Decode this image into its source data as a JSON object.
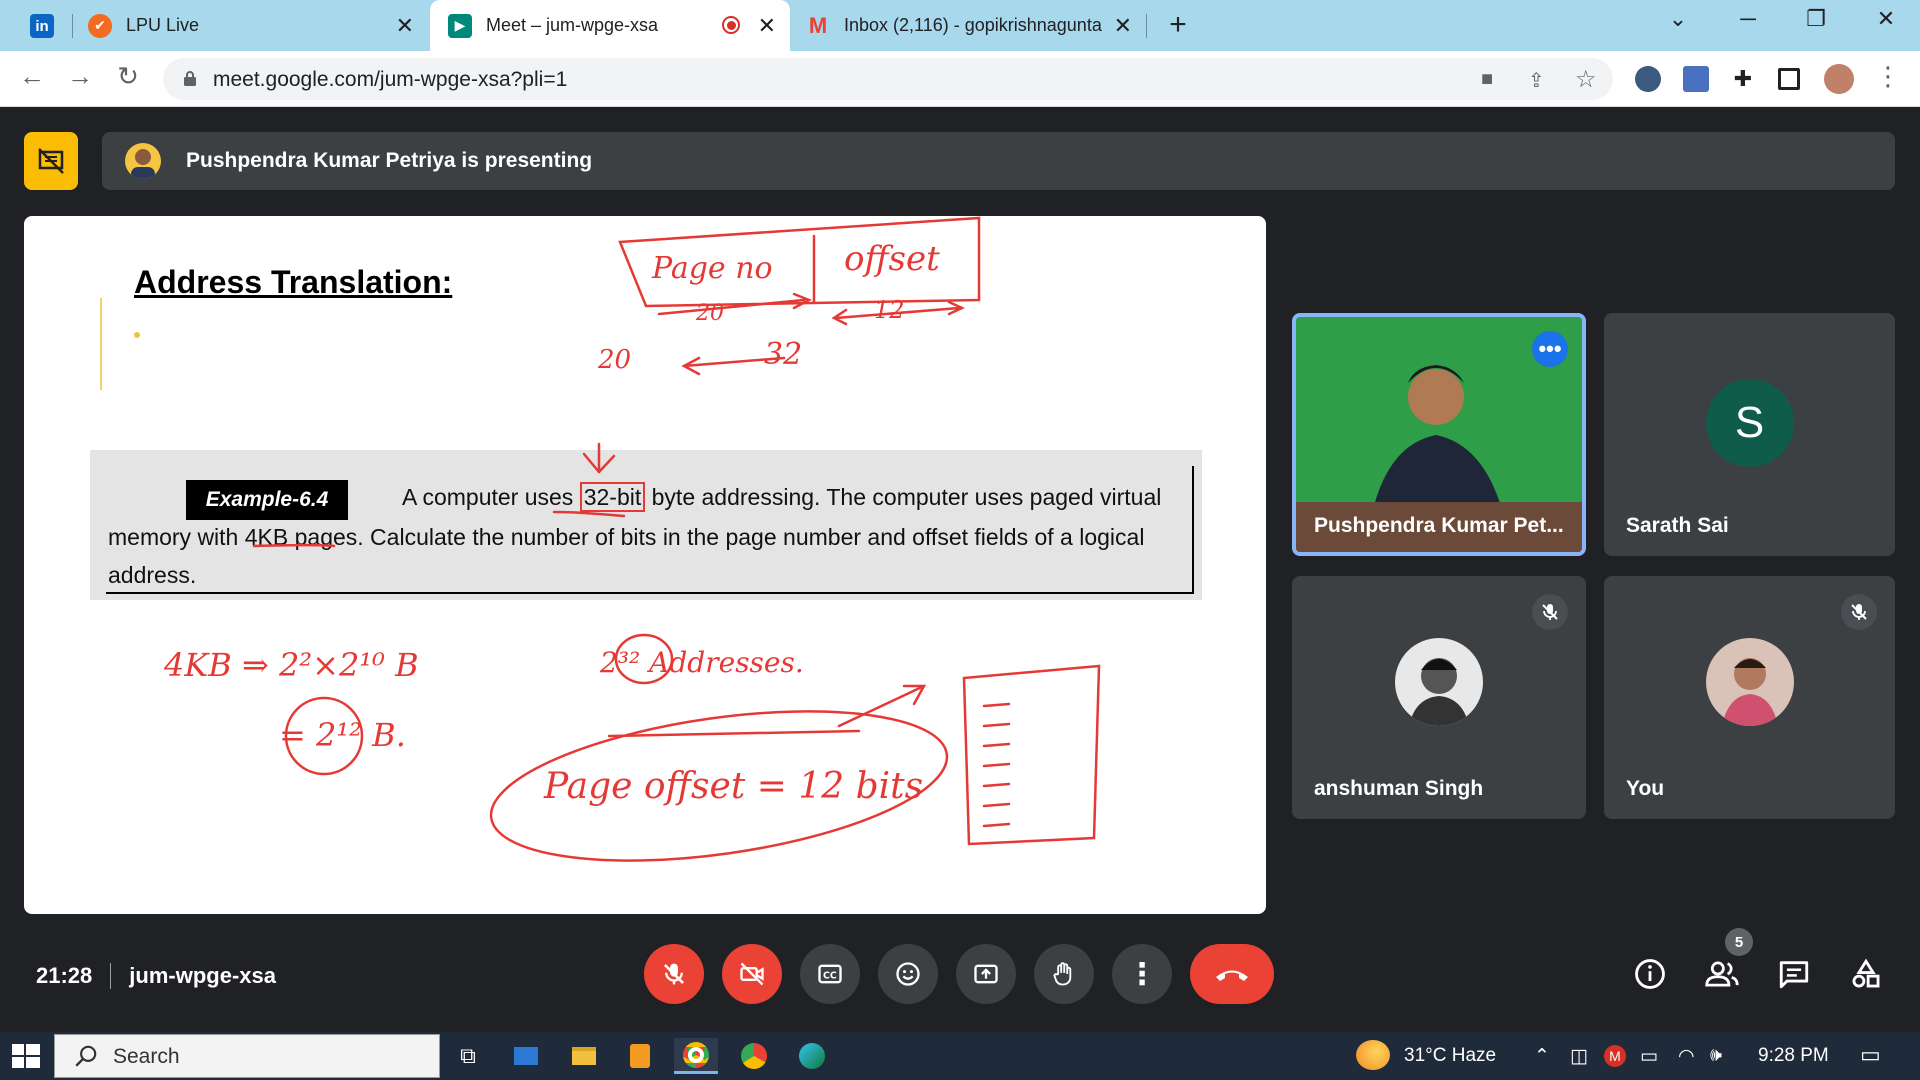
{
  "browser": {
    "tabs": [
      {
        "title": "LPU Live",
        "favicon": "lpu-icon"
      },
      {
        "title": "Meet – jum-wpge-xsa",
        "favicon": "google-meet-icon",
        "active": true,
        "recording": true
      },
      {
        "title": "Inbox (2,116) - gopikrishnagunta",
        "favicon": "gmail-icon"
      }
    ],
    "url": "meet.google.com/jum-wpge-xsa?pli=1"
  },
  "meet": {
    "presenting_text": "Pushpendra Kumar Petriya is presenting",
    "meeting_time": "21:28",
    "meeting_code": "jum-wpge-xsa",
    "participant_count": "5",
    "participants": [
      {
        "name": "Pushpendra Kumar Pet...",
        "type": "video",
        "speaking": true
      },
      {
        "name": "Sarath Sai",
        "initial": "S",
        "avatar_color": "#0f5c4a"
      },
      {
        "name": "anshuman Singh",
        "muted": true
      },
      {
        "name": "You",
        "muted": true
      }
    ]
  },
  "slide": {
    "title": "Address Translation:",
    "example_label": "Example-6.4",
    "example_line1a": "A computer uses",
    "example_line1_highlight": "32-bit",
    "example_line1b": "byte addressing. The computer uses paged virtual",
    "example_line2": "memory with 4KB pages. Calculate the number of bits in the page number and offset fields of a logical",
    "example_line3": "address.",
    "annotations": {
      "page_no": "Page no",
      "offset": "offset",
      "twenty_arrow": "20",
      "twelve_arrow": "12",
      "twenty": "20",
      "thirty_two": "32",
      "four_kb": "4KB ⇒ 2²×2¹⁰ B",
      "two_twelve": "= 2¹² B.",
      "addresses": "2³² Addresses.",
      "page_offset": "Page offset = 12 bits"
    }
  },
  "taskbar": {
    "search_placeholder": "Search",
    "weather": "31°C  Haze",
    "time": "9:28 PM"
  },
  "colors": {
    "meet_bg": "#202124",
    "tile_bg": "#3c4043",
    "red": "#ea4335",
    "accent_blue": "#8ab4f8",
    "ink_red": "#e53935"
  }
}
